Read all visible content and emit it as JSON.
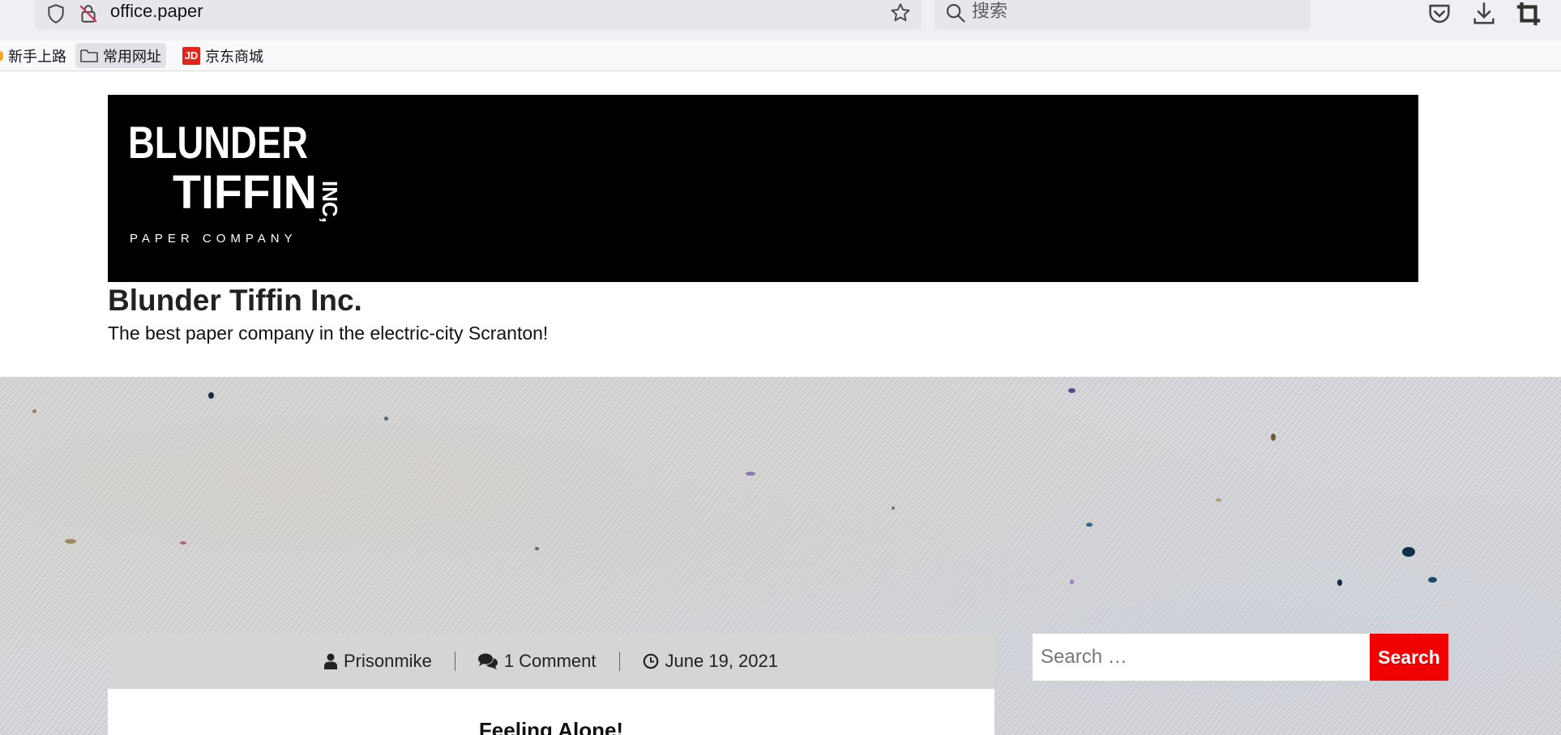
{
  "browser": {
    "url": "office.paper",
    "search_placeholder": "搜索",
    "icons": [
      "shield-icon",
      "insecure-lock-icon",
      "bookmark-star-icon",
      "search-icon",
      "pocket-icon",
      "download-icon",
      "crop-icon"
    ]
  },
  "bookmarks": [
    {
      "label": "新手上路",
      "icon": "firefox-icon"
    },
    {
      "label": "常用网址",
      "icon": "folder-icon"
    },
    {
      "label": "京东商城",
      "icon": "jd-icon",
      "icon_text": "JD"
    }
  ],
  "site": {
    "logo": {
      "line1": "BLUNDER",
      "line2": "TIFFIN",
      "suffix": "INC,",
      "sub": "PAPER COMPANY"
    },
    "title": "Blunder Tiffin Inc.",
    "tagline": "The best paper company in the electric-city Scranton!"
  },
  "post": {
    "author": "Prisonmike",
    "comments": "1 Comment",
    "date": "June 19, 2021",
    "title": "Feeling Alone!"
  },
  "sidebar": {
    "search_placeholder": "Search …",
    "search_button": "Search"
  },
  "colors": {
    "accent_red": "#f00000",
    "banner_bg": "#000000",
    "meta_bg": "#d5d5d5",
    "chrome_bg": "#f0f0f4"
  }
}
